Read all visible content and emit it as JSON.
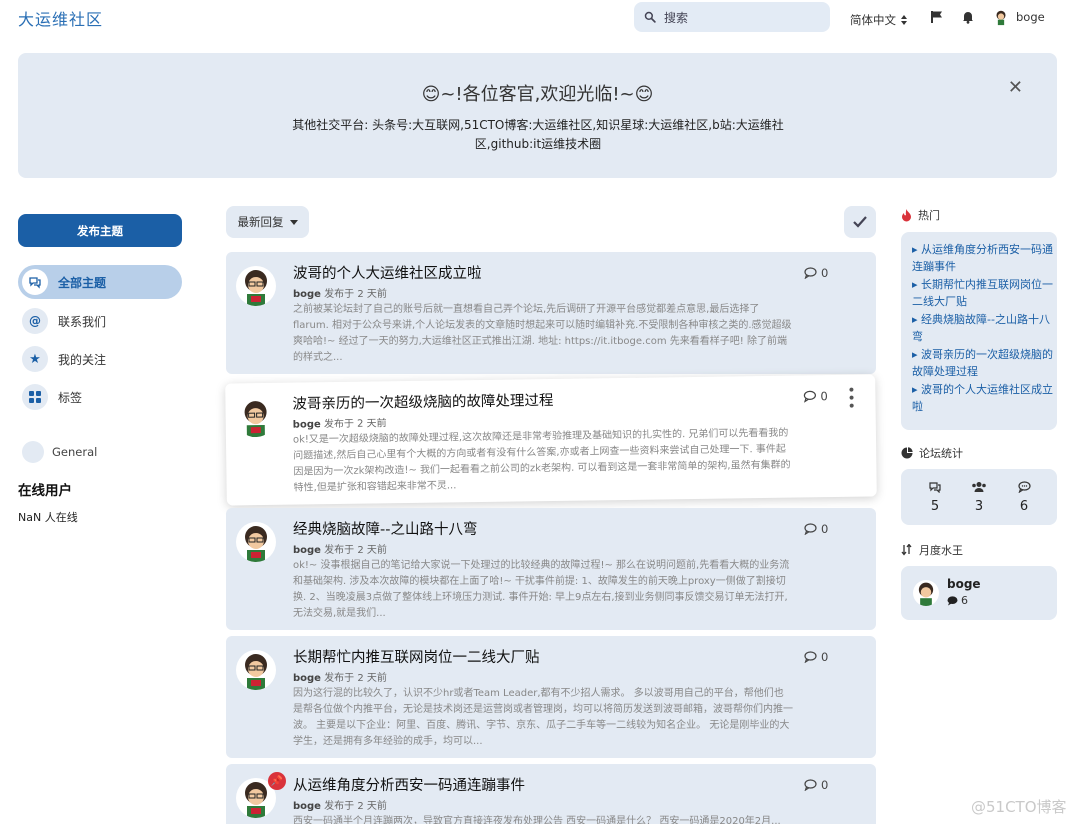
{
  "header": {
    "site_title": "大运维社区",
    "search_placeholder": "搜索",
    "language": "简体中文",
    "username": "boge"
  },
  "hero": {
    "title": "😊~!各位客官,欢迎光临!~😊",
    "text": "其他社交平台: 头条号:大互联网,51CTO博客:大运维社区,知识星球:大运维社区,b站:大运维社区,github:it运维技术圈"
  },
  "sidebar": {
    "new_topic": "发布主题",
    "items": [
      {
        "label": "全部主题",
        "icon": "chat-icon"
      },
      {
        "label": "联系我们",
        "icon": "at-icon"
      },
      {
        "label": "我的关注",
        "icon": "star-icon"
      },
      {
        "label": "标签",
        "icon": "grid-icon"
      }
    ],
    "tag": "General",
    "online_title": "在线用户",
    "online_count": "NaN 人在线"
  },
  "toolbar": {
    "sort_label": "最新回复"
  },
  "discussions": [
    {
      "title": "波哥的个人大运维社区成立啦",
      "author": "boge",
      "meta": " 发布于 2 天前",
      "replies": "0",
      "excerpt": "之前被某论坛封了自己的账号后就一直想看自己弄个论坛,先后调研了开源平台感觉都差点意思,最后选择了flarum. 相对于公众号来讲,个人论坛发表的文章随时想起来可以随时编辑补充.不受限制各种审核之类的.感觉超级爽哈哈!~ 经过了一天的努力,大运维社区正式推出江湖. 地址: https://it.itboge.com 先来看看样子吧! 除了前端的样式之..."
    },
    {
      "title": "波哥亲历的一次超级烧脑的故障处理过程",
      "author": "boge",
      "meta": " 发布于 2 天前",
      "replies": "0",
      "excerpt": "ok!又是一次超级烧脑的故障处理过程,这次故障还是非常考验推理及基础知识的扎实性的. 兄弟们可以先看看我的问题描述,然后自己心里有个大概的方向或者有没有什么答案,亦或者上网查一些资料来尝试自己处理一下. 事件起因是因为一次zk架构改造!~ 我们一起看看之前公司的zk老架构. 可以看到这是一套非常简单的架构,虽然有集群的特性,但是扩张和容错起来非常不灵..."
    },
    {
      "title": "经典烧脑故障--之山路十八弯",
      "author": "boge",
      "meta": " 发布于 2 天前",
      "replies": "0",
      "excerpt": "ok!~ 没事根据自己的笔记给大家说一下处理过的比较经典的故障过程!~ 那么在说明问题前,先看看大概的业务流和基础架构. 涉及本次故障的模块都在上面了哈!~ 干扰事件前提: 1、故障发生的前天晚上proxy一侧做了割接切换. 2、当晚凌晨3点做了整体线上环境压力测试. 事件开始: 早上9点左右,接到业务侧同事反馈交易订单无法打开,无法交易,就是我们..."
    },
    {
      "title": "长期帮忙内推互联网岗位一二线大厂贴",
      "author": "boge",
      "meta": " 发布于 2 天前",
      "replies": "0",
      "excerpt": "因为这行混的比较久了，认识不少hr或者Team Leader,都有不少招人需求。 多以波哥用自己的平台，帮他们也是帮各位做个内推平台，无论是技术岗还是运营岗或者管理岗，均可以将简历发送到波哥邮箱，波哥帮你们内推一波。 主要是以下企业：阿里、百度、腾讯、字节、京东、瓜子二手车等一二线较为知名企业。 无论是刚毕业的大学生，还是拥有多年经验的成手，均可以..."
    },
    {
      "title": "从运维角度分析西安一码通连蹦事件",
      "author": "boge",
      "meta": " 发布于 2 天前",
      "replies": "0",
      "excerpt": "西安一码通半个月连蹦两次，导致官方直接连夜发布处理公告 西安一码通是什么？ 西安一码通是2020年2月..."
    }
  ],
  "right": {
    "hot_title": "热门",
    "hot_items": [
      "从运维角度分析西安一码通连蹦事件",
      "长期帮忙内推互联网岗位一二线大厂贴",
      "经典烧脑故障--之山路十八弯",
      "波哥亲历的一次超级烧脑的故障处理过程",
      "波哥的个人大运维社区成立啦"
    ],
    "stats_title": "论坛统计",
    "stats": {
      "discussions": "5",
      "users": "3",
      "posts": "6"
    },
    "water_title": "月度水王",
    "water_user": "boge",
    "water_count": "6"
  },
  "watermark": "@51CTO博客"
}
